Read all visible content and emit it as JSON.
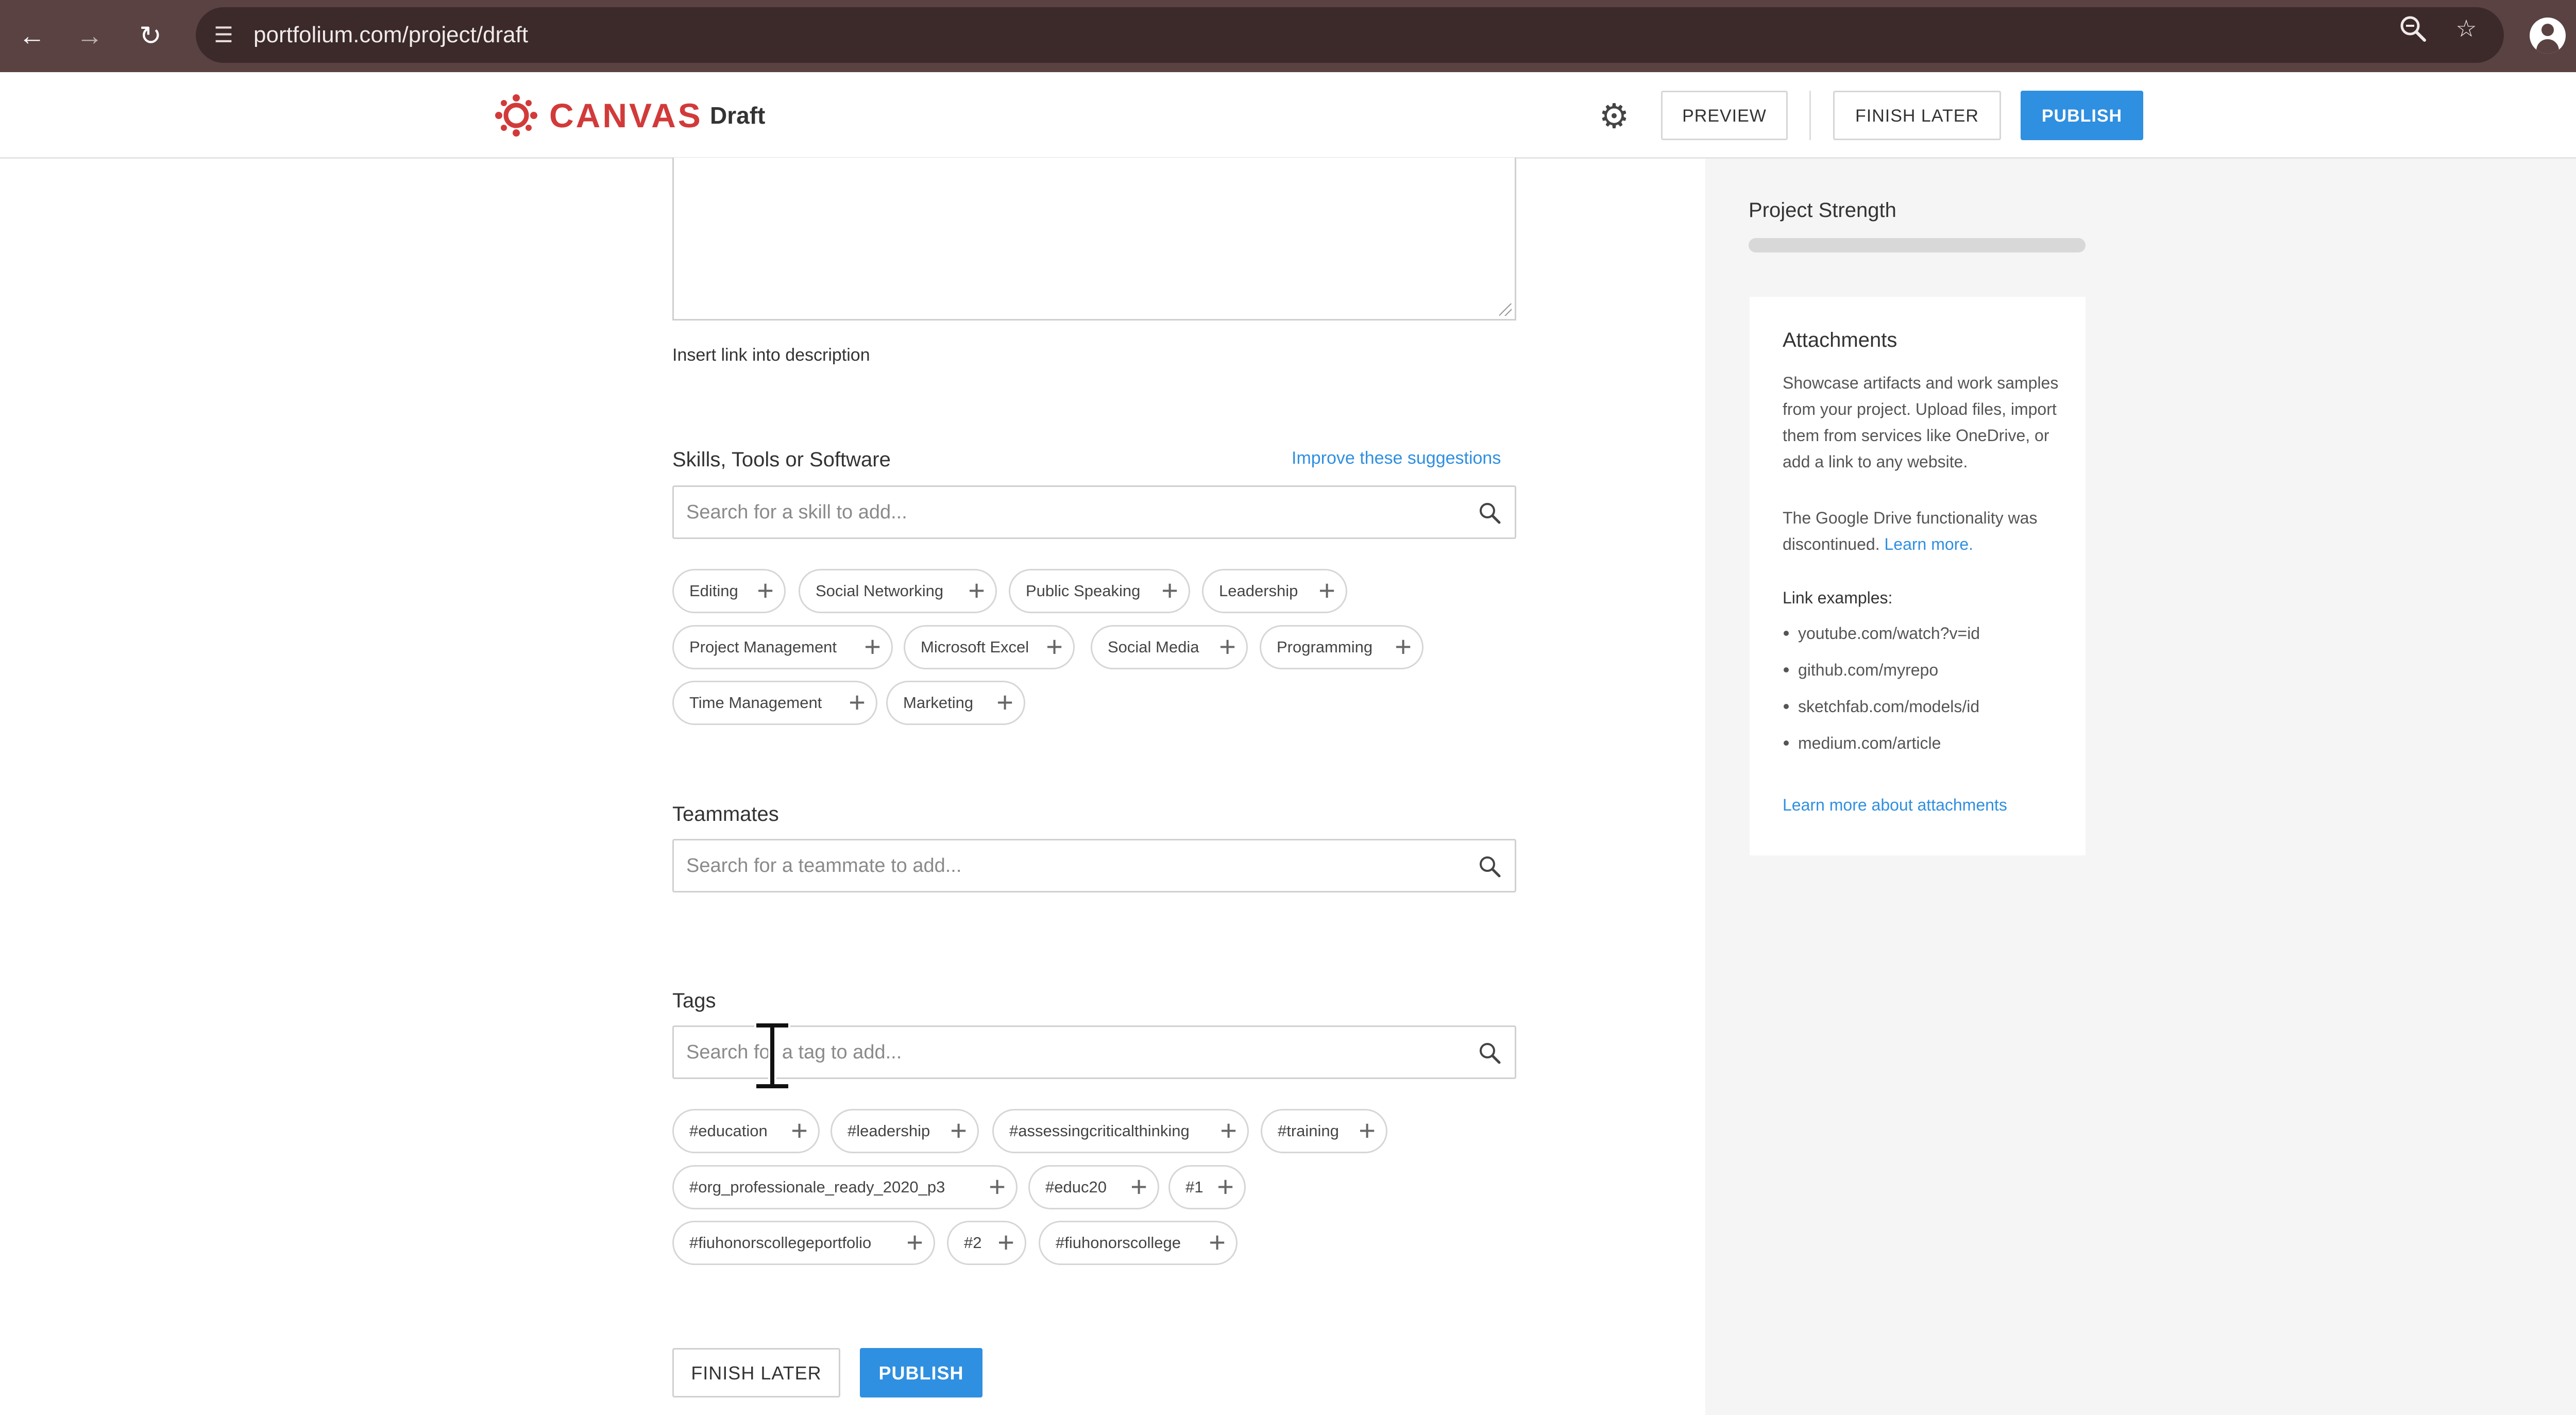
{
  "browser": {
    "url": "portfolium.com/project/draft",
    "icons": [
      "back-icon",
      "forward-icon",
      "reload-icon",
      "site-settings-icon",
      "zoom-icon",
      "bookmark-star-icon",
      "profile-icon",
      "menu-icon"
    ]
  },
  "header": {
    "logo_text": "CANVAS",
    "title": "Draft",
    "preview_label": "PREVIEW",
    "finish_later_label": "FINISH LATER",
    "publish_label": "PUBLISH"
  },
  "description": {
    "insert_link_label": "Insert link into description"
  },
  "skills": {
    "label": "Skills, Tools or Software",
    "improve_link": "Improve these suggestions",
    "placeholder": "Search for a skill to add...",
    "suggestions": [
      "Editing",
      "Social Networking",
      "Public Speaking",
      "Leadership",
      "Project Management",
      "Microsoft Excel",
      "Social Media",
      "Programming",
      "Time Management",
      "Marketing"
    ]
  },
  "teammates": {
    "label": "Teammates",
    "placeholder": "Search for a teammate to add..."
  },
  "tags": {
    "label": "Tags",
    "placeholder": "Search for a tag to add...",
    "suggestions": [
      "#education",
      "#leadership",
      "#assessingcriticalthinking",
      "#training",
      "#org_professionale_ready_2020_p3",
      "#educ20",
      "#1",
      "#fiuhonorscollegeportfolio",
      "#2",
      "#fiuhonorscollege"
    ]
  },
  "footer": {
    "finish_later_label": "FINISH LATER",
    "publish_label": "PUBLISH"
  },
  "sidebar": {
    "strength_label": "Project Strength",
    "strength_fraction": 0,
    "attachments": {
      "title": "Attachments",
      "description": "Showcase artifacts and work samples from your project. Upload files, import them from services like OneDrive, or add a link to any website.",
      "notice": "The Google Drive functionality was discontinued.",
      "notice_link": "Learn more.",
      "examples_label": "Link examples:",
      "examples": [
        "youtube.com/watch?v=id",
        "github.com/myrepo",
        "sketchfab.com/models/id",
        "medium.com/article"
      ],
      "learn_more": "Learn more about attachments"
    }
  },
  "colors": {
    "accent": "#2f8fe0",
    "brand": "#d23a3a",
    "chrome": "#5a4242"
  }
}
